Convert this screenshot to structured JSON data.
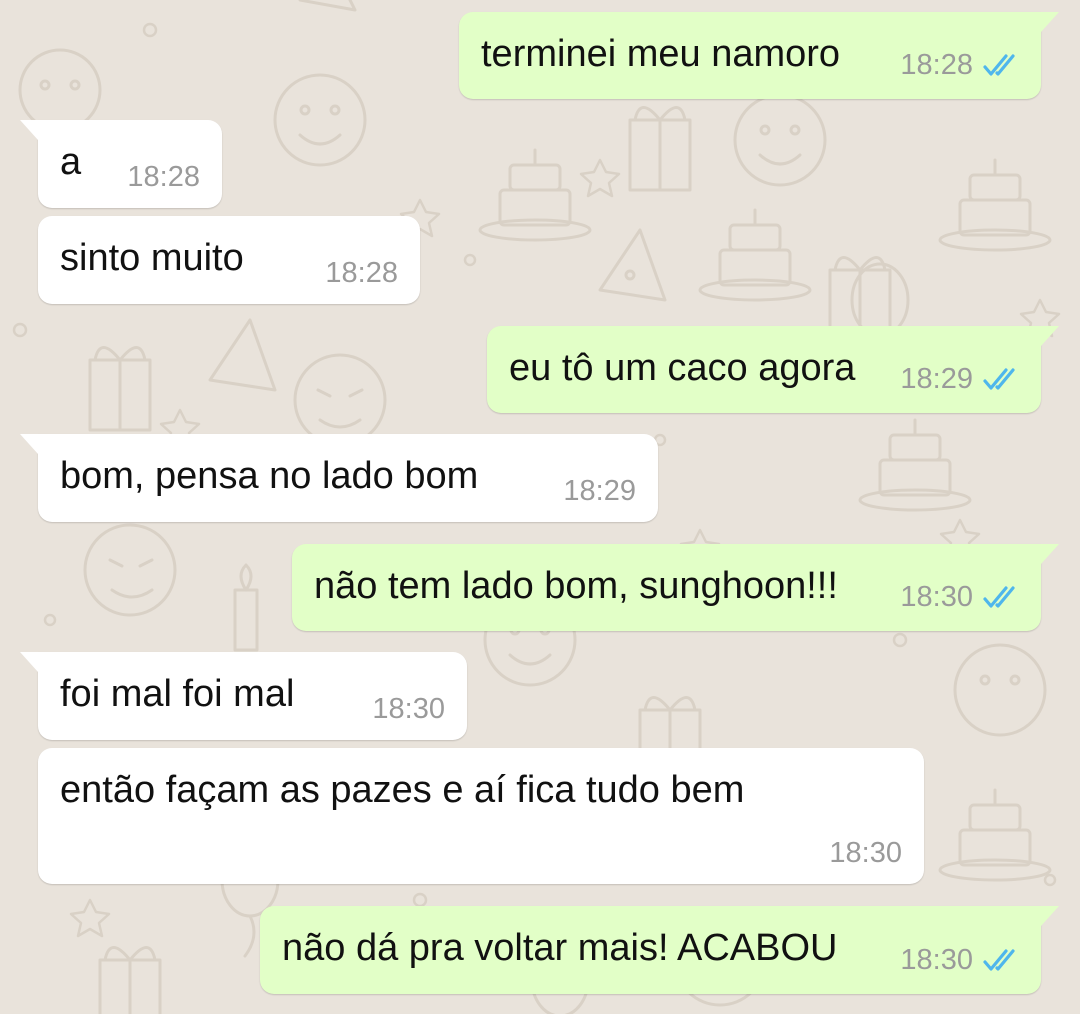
{
  "colors": {
    "wallpaper": "#e9e3db",
    "incoming_bubble": "#ffffff",
    "outgoing_bubble": "#e2ffc7",
    "timestamp": "#9a9a9a",
    "read_ticks": "#4fb6ec"
  },
  "messages": [
    {
      "direction": "outgoing",
      "text": "terminei meu namoro",
      "time": "18:28",
      "status_icon": "double-check-read-icon"
    },
    {
      "direction": "incoming",
      "text": "a",
      "time": "18:28"
    },
    {
      "direction": "incoming",
      "text": "sinto muito",
      "time": "18:28"
    },
    {
      "direction": "outgoing",
      "text": "eu tô um caco agora",
      "time": "18:29",
      "status_icon": "double-check-read-icon"
    },
    {
      "direction": "incoming",
      "text": "bom, pensa no lado bom",
      "time": "18:29"
    },
    {
      "direction": "outgoing",
      "text": "não tem lado bom, sunghoon!!!",
      "time": "18:30",
      "status_icon": "double-check-read-icon"
    },
    {
      "direction": "incoming",
      "text": "foi mal foi mal",
      "time": "18:30"
    },
    {
      "direction": "incoming",
      "text": "então façam as pazes e aí fica tudo bem",
      "time": "18:30"
    },
    {
      "direction": "outgoing",
      "text": "não dá pra voltar mais! ACABOU",
      "time": "18:30",
      "status_icon": "double-check-read-icon"
    }
  ]
}
